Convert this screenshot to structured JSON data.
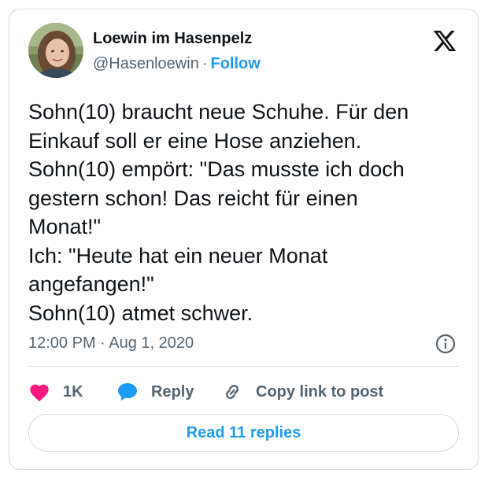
{
  "author": {
    "name": "Loewin im Hasenpelz",
    "handle": "@Hasenloewin",
    "separator": "·",
    "follow_label": "Follow"
  },
  "tweet": {
    "text": "Sohn(10) braucht neue Schuhe. Für den\nEinkauf soll er eine Hose anziehen.\nSohn(10) empört: \"Das musste ich doch\ngestern schon! Das reicht für einen\nMonat!\"\nIch: \"Heute hat ein neuer Monat\nangefangen!\"\nSohn(10) atmet schwer.",
    "timestamp": "12:00 PM · Aug 1, 2020"
  },
  "actions": {
    "like_count": "1K",
    "reply_label": "Reply",
    "copy_link_label": "Copy link to post"
  },
  "read_replies_label": "Read 11 replies",
  "icons": {
    "logo": "x-logo-icon",
    "info": "info-icon",
    "like": "heart-icon",
    "reply": "speech-bubble-icon",
    "copy": "link-icon"
  },
  "colors": {
    "accent": "#1d9bf0",
    "like": "#f91880",
    "text": "#0f1419",
    "secondary": "#536471",
    "border": "#cfd9de"
  }
}
